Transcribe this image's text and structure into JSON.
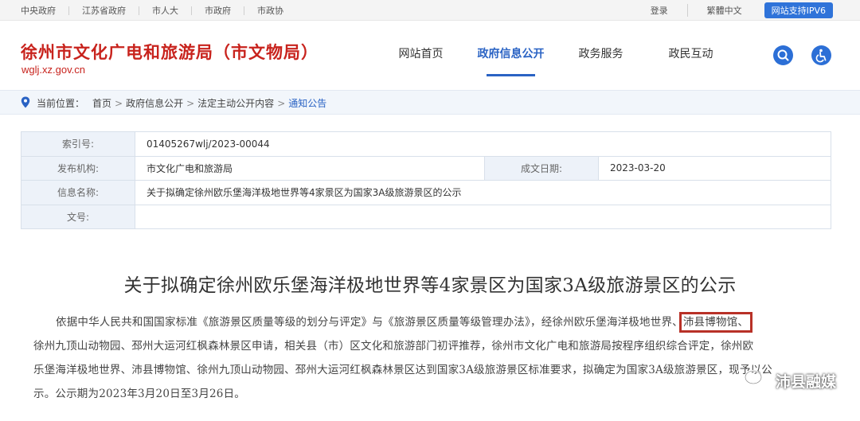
{
  "topbar": {
    "links": [
      "中央政府",
      "江苏省政府",
      "市人大",
      "市政府",
      "市政协"
    ],
    "login": "登录",
    "trad_chinese": "繁體中文",
    "ipv6": "网站支持IPV6"
  },
  "header": {
    "title": "徐州市文化广电和旅游局（市文物局）",
    "url": "wglj.xz.gov.cn",
    "nav": [
      "网站首页",
      "政府信息公开",
      "政务服务",
      "政民互动"
    ],
    "active_nav": "政府信息公开",
    "icons": [
      "search-icon",
      "accessibility-icon"
    ]
  },
  "breadcrumb": {
    "label": "当前位置：",
    "items": [
      "首页",
      "政府信息公开",
      "法定主动公开内容",
      "通知公告"
    ]
  },
  "meta": {
    "index_label": "索引号:",
    "index_value": "01405267wlj/2023-00044",
    "publisher_label": "发布机构:",
    "publisher_value": "市文化广电和旅游局",
    "date_label": "成文日期:",
    "date_value": "2023-03-20",
    "name_label": "信息名称:",
    "name_value": "关于拟确定徐州欧乐堡海洋极地世界等4家景区为国家3A级旅游景区的公示",
    "doc_label": "文号:",
    "doc_value": ""
  },
  "article": {
    "title": "关于拟确定徐州欧乐堡海洋极地世界等4家景区为国家3A级旅游景区的公示",
    "line1_a": "依据中华人民共和国国家标准《旅游景区质量等级的划分与评定》与《旅游景区质量等级管理办法》，经徐州欧乐堡海洋极地世界、",
    "line1_hl": "沛县博物馆、",
    "line2": "徐州九顶山动物园、邳州大运河红枫森林景区申请，相关县（市）区文化和旅游部门初评推荐，徐州市文化广电和旅游局按程序组织综合评定，徐州欧",
    "line3": "乐堡海洋极地世界、沛县博物馆、徐州九顶山动物园、邳州大运河红枫森林景区达到国家3A级旅游景区标准要求，拟确定为国家3A级旅游景区，现予以公",
    "line4": "示。公示期为2023年3月20日至3月26日。"
  },
  "watermark": {
    "text": "沛县融媒"
  },
  "colors": {
    "brand_red": "#c8231d",
    "nav_blue": "#2a63c4",
    "highlight_box": "#b83127"
  }
}
